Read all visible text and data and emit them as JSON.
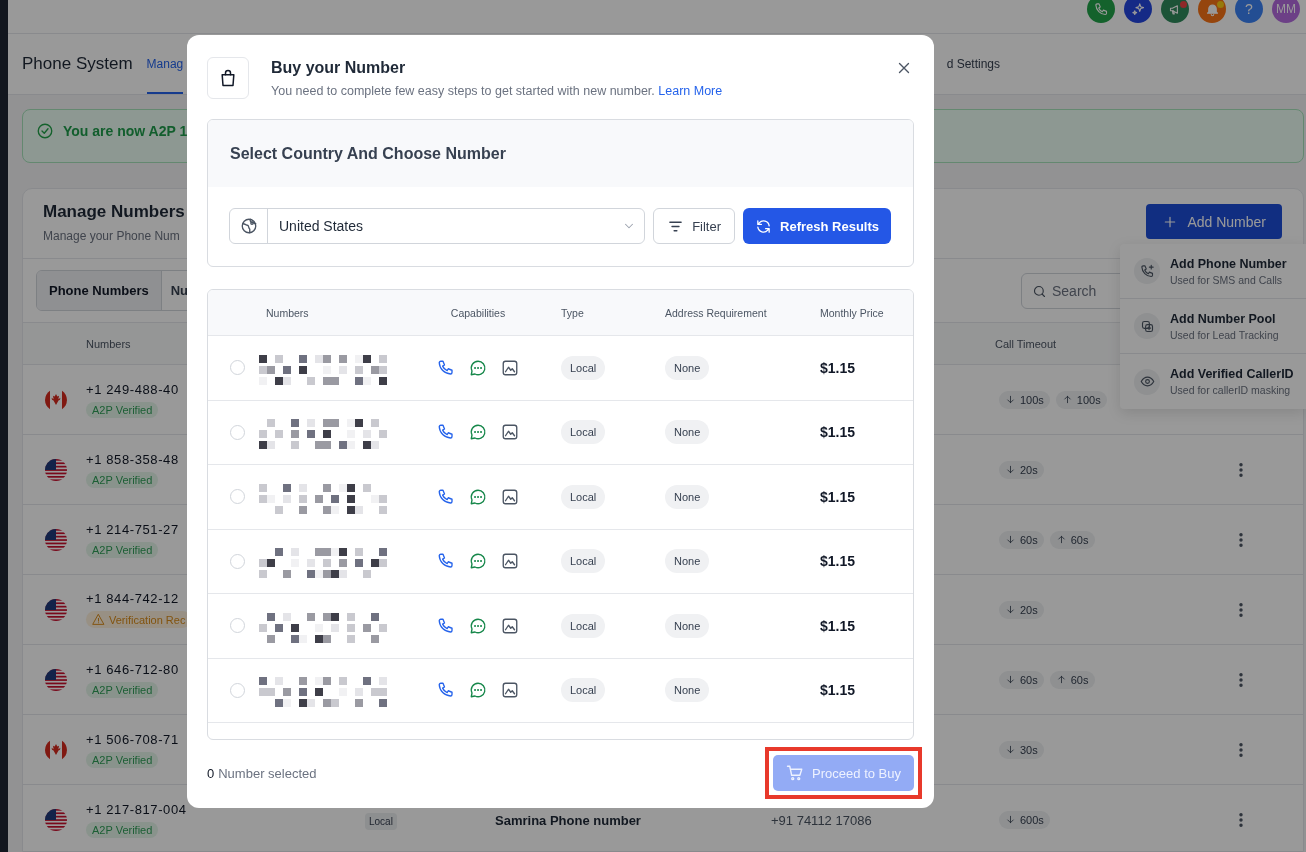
{
  "top_bar": {
    "icons": [
      {
        "kind": "phone"
      },
      {
        "kind": "sparkle"
      },
      {
        "kind": "megaphone",
        "dot": {
          "color": "#8f2929"
        }
      },
      {
        "kind": "bell",
        "dot": {
          "color": "#967a0d"
        }
      },
      {
        "kind": "help",
        "label": "?"
      },
      {
        "kind": "avatar",
        "label": "MM"
      }
    ]
  },
  "header": {
    "title": "Phone System",
    "tabs": [
      {
        "label": "Manag",
        "selected": true
      },
      {
        "label": "d Settings",
        "selected": false
      }
    ]
  },
  "alert": {
    "text": "You are now A2P 1"
  },
  "card": {
    "title": "Manage Numbers",
    "subtitle": "Manage your Phone Num",
    "add_button": "Add Number",
    "segments": [
      {
        "label": "Phone Numbers",
        "selected": true
      },
      {
        "label": "Nu",
        "selected": false
      }
    ],
    "search": {
      "placeholder": "Search"
    },
    "columns": [
      "Numbers",
      "Call Timeout"
    ],
    "rows": [
      {
        "flag": {
          "kind": "ca"
        },
        "number": "+1 249-488-40",
        "badge": {
          "kind": "verified",
          "text": "A2P Verified"
        },
        "timeout": {
          "down": "100s",
          "up": "100s"
        },
        "more_button": false
      },
      {
        "flag": {
          "kind": "us"
        },
        "number": "+1 858-358-48",
        "badge": {
          "kind": "verified",
          "text": "A2P Verified"
        },
        "timeout": {
          "down": "20s"
        },
        "more_button": true
      },
      {
        "flag": {
          "kind": "us"
        },
        "number": "+1 214-751-27",
        "badge": {
          "kind": "verified",
          "text": "A2P Verified"
        },
        "timeout": {
          "down": "60s",
          "up": "60s"
        },
        "more_button": true
      },
      {
        "flag": {
          "kind": "us"
        },
        "number": "+1 844-742-12",
        "badge": {
          "kind": "warning",
          "text": "Verification Rec"
        },
        "timeout": {
          "down": "20s"
        },
        "more_button": true
      },
      {
        "flag": {
          "kind": "us"
        },
        "number": "+1 646-712-80",
        "badge": {
          "kind": "verified",
          "text": "A2P Verified"
        },
        "timeout": {
          "down": "60s",
          "up": "60s"
        },
        "more_button": true
      },
      {
        "flag": {
          "kind": "ca"
        },
        "number": "+1 506-708-71",
        "badge": {
          "kind": "verified",
          "text": "A2P Verified"
        },
        "timeout": {
          "down": "30s"
        },
        "more_button": true
      },
      {
        "flag": {
          "kind": "us"
        },
        "number": "+1 217-817-004",
        "badge": {
          "kind": "verified",
          "text": "A2P Verified"
        },
        "type": "Local",
        "name": "Samrina Phone number",
        "forward": "+91 74112 17086",
        "timeout": {
          "down": "600s"
        },
        "more_button": true
      }
    ]
  },
  "add_menu": {
    "items": [
      {
        "kind": "phone-plus",
        "title": "Add Phone Number",
        "subtitle": "Used for SMS and Calls"
      },
      {
        "kind": "pool",
        "title": "Add Number Pool",
        "subtitle": "Used for Lead Tracking"
      },
      {
        "kind": "eye",
        "title": "Add Verified CallerID",
        "subtitle": "Used for callerID masking"
      }
    ]
  },
  "modal": {
    "title": "Buy your Number",
    "subtitle": "You need to complete few easy steps to get started with new number.",
    "link": "Learn More",
    "section_title": "Select Country And Choose Number",
    "country": {
      "value": "United States"
    },
    "filter_button": "Filter",
    "refresh_button": "Refresh Results",
    "columns": [
      "Numbers",
      "Capabilities",
      "Type",
      "Address Requirement",
      "Monthly Price"
    ],
    "rows": [
      {
        "selected": false,
        "capabilities": [
          {
            "kind": "voice"
          },
          {
            "kind": "sms"
          },
          {
            "kind": "mms"
          }
        ],
        "type": "Local",
        "address": "None",
        "price": "$1.15"
      },
      {
        "selected": false,
        "capabilities": [
          {
            "kind": "voice"
          },
          {
            "kind": "sms"
          },
          {
            "kind": "mms"
          }
        ],
        "type": "Local",
        "address": "None",
        "price": "$1.15"
      },
      {
        "selected": false,
        "capabilities": [
          {
            "kind": "voice"
          },
          {
            "kind": "sms"
          },
          {
            "kind": "mms"
          }
        ],
        "type": "Local",
        "address": "None",
        "price": "$1.15"
      },
      {
        "selected": false,
        "capabilities": [
          {
            "kind": "voice"
          },
          {
            "kind": "sms"
          },
          {
            "kind": "mms"
          }
        ],
        "type": "Local",
        "address": "None",
        "price": "$1.15"
      },
      {
        "selected": false,
        "capabilities": [
          {
            "kind": "voice"
          },
          {
            "kind": "sms"
          },
          {
            "kind": "mms"
          }
        ],
        "type": "Local",
        "address": "None",
        "price": "$1.15"
      },
      {
        "selected": false,
        "capabilities": [
          {
            "kind": "voice"
          },
          {
            "kind": "sms"
          },
          {
            "kind": "mms"
          }
        ],
        "type": "Local",
        "address": "None",
        "price": "$1.15"
      }
    ],
    "selected_count": "0",
    "selected_label": "Number selected",
    "buy_button": {
      "label": "Proceed to Buy",
      "disabled": true,
      "highlighted": true
    }
  }
}
